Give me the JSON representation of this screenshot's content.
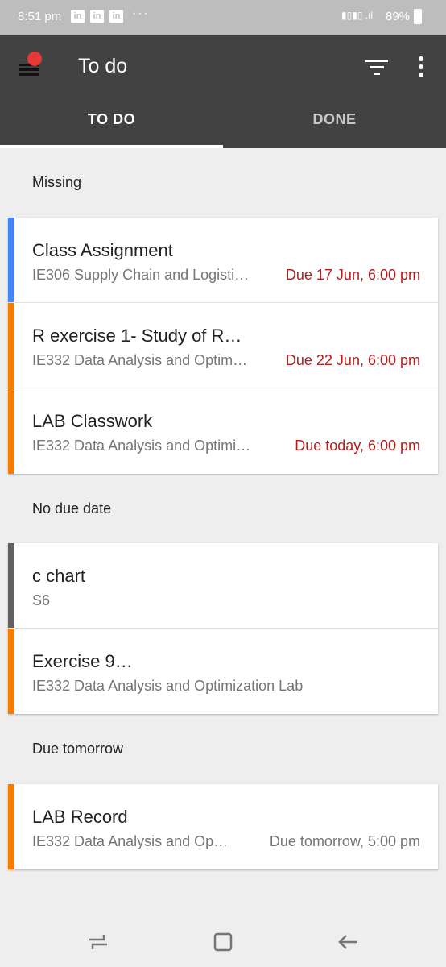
{
  "status": {
    "time": "8:51 pm",
    "notif_icons": [
      "in",
      "in",
      "in"
    ],
    "more": "···",
    "battery_pct": "89%"
  },
  "appbar": {
    "title": "To do"
  },
  "tabs": [
    {
      "label": "TO DO",
      "selected": true
    },
    {
      "label": "DONE",
      "selected": false
    }
  ],
  "sections": [
    {
      "label": "Missing",
      "items": [
        {
          "title": "Class Assignment",
          "subtitle": "IE306 Supply Chain and Logisti…",
          "due": "Due 17 Jun, 6:00 pm",
          "stripe": "#4285f4",
          "due_color": "#b71c1c"
        },
        {
          "title": "R exercise 1- Study of R…",
          "subtitle": "IE332 Data Analysis and Optim…",
          "due": "Due 22 Jun, 6:00 pm",
          "stripe": "#f57c00",
          "due_color": "#b71c1c"
        },
        {
          "title": "LAB Classwork",
          "subtitle": "IE332 Data Analysis and Optimi…",
          "due": "Due today, 6:00 pm",
          "stripe": "#f57c00",
          "due_color": "#b71c1c"
        }
      ]
    },
    {
      "label": "No due date",
      "items": [
        {
          "title": "c chart",
          "subtitle": "S6",
          "due": "",
          "stripe": "#616161",
          "due_color": "#757575"
        },
        {
          "title": "Exercise 9…",
          "subtitle": "IE332 Data Analysis and Optimization Lab",
          "due": "",
          "stripe": "#f57c00",
          "due_color": "#757575"
        }
      ]
    },
    {
      "label": "Due tomorrow",
      "items": [
        {
          "title": "LAB Record",
          "subtitle": "IE332 Data Analysis and Op…",
          "due": "Due tomorrow, 5:00 pm",
          "stripe": "#f57c00",
          "due_color": "#757575"
        }
      ]
    }
  ]
}
